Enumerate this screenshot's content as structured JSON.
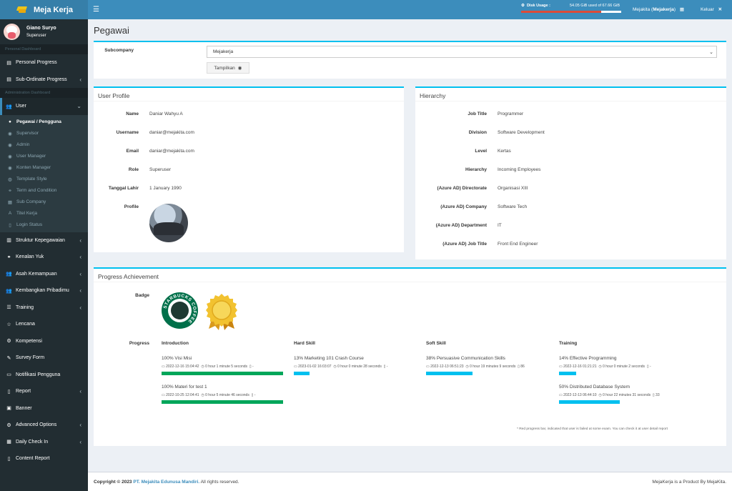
{
  "app": {
    "brand": "Meja Kerja"
  },
  "user_panel": {
    "name": "Giano Suryo",
    "role": "Superuser"
  },
  "sidebar": {
    "section_personal": "Personal Dashboard",
    "personal_progress": "Personal Progress",
    "subordinate_progress": "Sub-Ordinate Progress",
    "section_admin": "Administration Dashboard",
    "user": "User",
    "sub_items": [
      "Pegawai / Pengguna",
      "Supervisor",
      "Admin",
      "User Manager",
      "Konten Manager",
      "Template Style",
      "Term and Condition",
      "Sub Company",
      "Titel Kerja",
      "Login Status"
    ],
    "items": [
      "Struktur Kepegawaian",
      "Kenalan Yuk",
      "Asah Kemampuan",
      "Kembangkan Pribadimu",
      "Training",
      "Lencana",
      "Kompetensi",
      "Survey Form",
      "Notifikasi Pengguna",
      "Report",
      "Banner",
      "Advanced Options",
      "Daily Check In",
      "Content Report"
    ]
  },
  "header": {
    "disk_label": "Disk Usage :",
    "disk_value": "54.05 GiB used of 67.66 GiB",
    "disk_fraction": 0.799,
    "user_prefix": "Mejakita (",
    "user_bold": "Mejakerja",
    "user_suffix": ")",
    "logout": "Keluar"
  },
  "page": {
    "title": "Pegawai"
  },
  "filter": {
    "label": "Subcompany",
    "selected": "Mejakerja",
    "button": "Tampilkan"
  },
  "user_profile": {
    "title": "User Profile",
    "fields": [
      {
        "label": "Name",
        "value": "Daniar Wahyu A"
      },
      {
        "label": "Username",
        "value": "daniar@mejakita.com"
      },
      {
        "label": "Email",
        "value": "daniar@mejakita.com"
      },
      {
        "label": "Role",
        "value": "Superuser"
      },
      {
        "label": "Tanggal Lahir",
        "value": "1 January 1990"
      },
      {
        "label": "Profile",
        "value": ""
      }
    ]
  },
  "hierarchy": {
    "title": "Hierarchy",
    "fields": [
      {
        "label": "Job Title",
        "value": "Programmer"
      },
      {
        "label": "Division",
        "value": "Software Development"
      },
      {
        "label": "Level",
        "value": "Kertas"
      },
      {
        "label": "Hierarchy",
        "value": "Incoming Employees"
      },
      {
        "label": "(Azure AD) Directorate",
        "value": "Organisasi XIII"
      },
      {
        "label": "(Azure AD) Company",
        "value": "Software Tech"
      },
      {
        "label": "(Azure AD) Department",
        "value": "IT"
      },
      {
        "label": "(Azure AD) Job Title",
        "value": "Front End Engineer"
      }
    ]
  },
  "progress": {
    "title": "Progress Achievement",
    "badge_label": "Badge",
    "badge_text": "STARBUCKS COFFEE",
    "progress_label": "Progress",
    "columns": [
      {
        "title": "Introduction",
        "items": [
          {
            "title": "100% Visi Misi",
            "date": "2022-12-16 15:04:42",
            "duration": "0 hour 1 minute 5 seconds",
            "count": "-",
            "percent": 100,
            "color": "#00a65a"
          },
          {
            "title": "100% Materi for test 1",
            "date": "2022-10-25 12:04:41",
            "duration": "0 hour 5 minute 46 seconds",
            "count": "-",
            "percent": 100,
            "color": "#00a65a"
          }
        ]
      },
      {
        "title": "Hard Skill",
        "items": [
          {
            "title": "13% Marketing 101 Crash Course",
            "date": "2023-01-02 16:03:07",
            "duration": "0 hour 0 minute 28 seconds",
            "count": "-",
            "percent": 13,
            "color": "#00c0ef"
          }
        ]
      },
      {
        "title": "Soft Skill",
        "items": [
          {
            "title": "38% Persuasive Communication Skills",
            "date": "2022-12-13 06:51:23",
            "duration": "0 hour 19 minutes 9 seconds",
            "count": "86",
            "percent": 38,
            "color": "#00c0ef"
          }
        ]
      },
      {
        "title": "Training",
        "items": [
          {
            "title": "14% Effective Programming",
            "date": "2022-12-16 01:21:21",
            "duration": "0 hour 0 minute 2 seconds",
            "count": "-",
            "percent": 14,
            "color": "#00c0ef"
          },
          {
            "title": "50% Distributed Database System",
            "date": "2022-12-13 06:44:10",
            "duration": "0 hour 22 minutes 31 seconds",
            "count": "33",
            "percent": 50,
            "color": "#00c0ef"
          }
        ]
      }
    ],
    "note": "* Red progress bar, indicated that user is failed at some exam. You can check it at user detail report"
  },
  "footer": {
    "copyright": "Copyright © 2023",
    "company": "PT. Mejakita Edunusa Mandiri.",
    "rights": "All rights reserved.",
    "product": "MejaKerja is a Product By MejaKita."
  }
}
